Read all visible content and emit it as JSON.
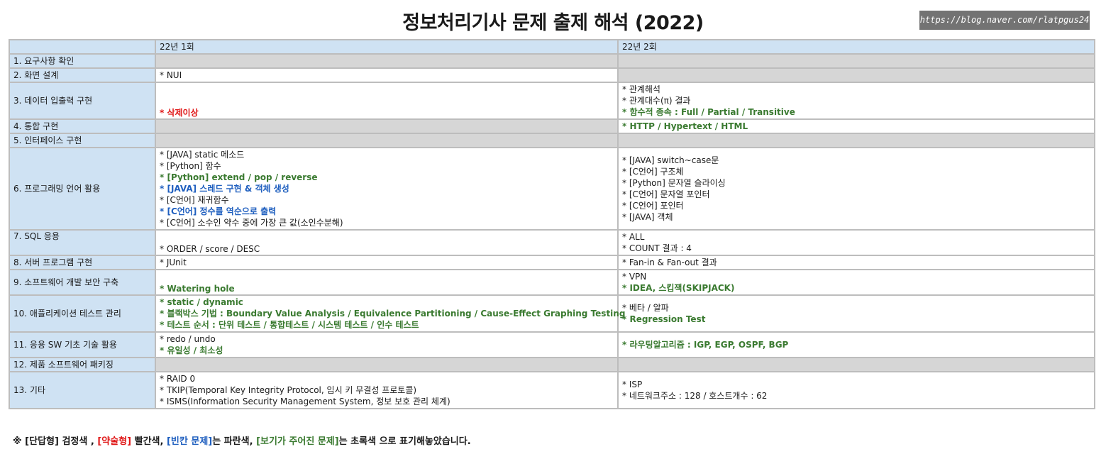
{
  "title": "정보처리기사 문제 출제 해석 (2022)",
  "watermark": "https://blog.naver.com/rlatpgus24",
  "table": {
    "headers": [
      "",
      "22년 1회",
      "22년 2회"
    ],
    "rows": [
      {
        "category": "1. 요구사항 확인",
        "c1": [],
        "c2": [],
        "h": 20
      },
      {
        "category": "2. 화면 설계",
        "c1": [
          {
            "t": "* NUI",
            "s": "plain"
          }
        ],
        "c2": [],
        "h": 20
      },
      {
        "category": "3. 데이터 입출력 구현",
        "c1": [
          {
            "t": "* 삭제이상",
            "s": "red"
          }
        ],
        "c2": [
          {
            "t": "* 관계해석",
            "s": "plain"
          },
          {
            "t": "* 관계대수(π) 결과",
            "s": "plain"
          },
          {
            "t": "* 함수적 종속 : Full / Partial / Transitive",
            "s": "green"
          }
        ],
        "c1_align": "bottom",
        "h": 52
      },
      {
        "category": "4. 통합 구현",
        "c1": [],
        "c2": [
          {
            "t": "* HTTP / Hypertext / HTML",
            "s": "green"
          }
        ],
        "h": 20
      },
      {
        "category": "5. 인터페이스 구현",
        "c1": [],
        "c2": [],
        "h": 20
      },
      {
        "category": "6. 프로그래밍 언어 활용",
        "c1": [
          {
            "t": "* [JAVA] static 메소드",
            "s": "plain"
          },
          {
            "t": "* [Python] 함수",
            "s": "plain"
          },
          {
            "t": "* [Python] extend / pop / reverse",
            "s": "green"
          },
          {
            "t": "* [JAVA] 스레드 구현 & 객체 생성",
            "s": "blue"
          },
          {
            "t": "* [C언어] 재귀함수",
            "s": "plain"
          },
          {
            "t": "* [C언어] 정수를 역순으로 출력",
            "s": "blue"
          },
          {
            "t": "* [C언어] 소수인 약수 중에 가장 큰 값(소인수분해)",
            "s": "plain"
          }
        ],
        "c2": [
          {
            "t": "* [JAVA] switch~case문",
            "s": "plain"
          },
          {
            "t": "* [C언어] 구조체",
            "s": "plain"
          },
          {
            "t": "* [Python] 문자열 슬라이싱",
            "s": "plain"
          },
          {
            "t": "* [C언어] 문자열 포인터",
            "s": "plain"
          },
          {
            "t": "* [C언어] 포인터",
            "s": "plain"
          },
          {
            "t": "* [JAVA] 객체",
            "s": "plain"
          }
        ],
        "h": 116
      },
      {
        "category": "7. SQL 응용",
        "c1": [
          {
            "t": "* ORDER / score / DESC",
            "s": "plain"
          }
        ],
        "c2": [
          {
            "t": "* ALL",
            "s": "plain"
          },
          {
            "t": "* COUNT 결과 : 4",
            "s": "plain"
          }
        ],
        "c1_align": "bottom",
        "cat_align": "top",
        "h": 36
      },
      {
        "category": "8. 서버 프로그램 구현",
        "c1": [
          {
            "t": "* JUnit",
            "s": "plain"
          }
        ],
        "c2": [
          {
            "t": "* Fan-in & Fan-out 결과",
            "s": "plain"
          }
        ],
        "h": 20
      },
      {
        "category": "9. 소프트웨어 개발 보안 구축",
        "c1": [
          {
            "t": "* Watering hole",
            "s": "green"
          }
        ],
        "c2": [
          {
            "t": "* VPN",
            "s": "plain"
          },
          {
            "t": "* IDEA, 스킵잭(SKIPJACK)",
            "s": "green"
          }
        ],
        "c1_align": "bottom",
        "h": 36
      },
      {
        "category": "10. 애플리케이션 테스트 관리",
        "c1": [
          {
            "t": "* static / dynamic",
            "s": "green"
          },
          {
            "t": "* 블랙박스 기법 : Boundary Value Analysis / Equivalence Partitioning / Cause-Effect Graphing Testing",
            "s": "green"
          },
          {
            "t": "* 테스트 순서 : 단위 테스트 / 통합테스트 / 시스템 테스트 / 인수 테스트",
            "s": "green"
          }
        ],
        "c2": [
          {
            "t": "* 베타 / 알파",
            "s": "plain"
          },
          {
            "t": "* Regression Test",
            "s": "green"
          }
        ],
        "h": 52
      },
      {
        "category": "11. 응용 SW 기초 기술 활용",
        "c1": [
          {
            "t": "* redo / undo",
            "s": "plain"
          },
          {
            "t": "* 유일성 / 최소성",
            "s": "green"
          }
        ],
        "c2": [
          {
            "t": "* 라우팅알고리즘 : IGP, EGP, OSPF, BGP",
            "s": "green"
          }
        ],
        "h": 36
      },
      {
        "category": "12. 제품 소프트웨어 패키징",
        "c1": [],
        "c2": [],
        "h": 20
      },
      {
        "category": "13. 기타",
        "c1": [
          {
            "t": "* RAID 0",
            "s": "plain"
          },
          {
            "t": "* TKIP(Temporal Key Integrity Protocol, 임시 키 무결성 프로토콜)",
            "s": "plain"
          },
          {
            "t": "* ISMS(Information Security Management System, 정보 보호 관리 체계)",
            "s": "plain"
          }
        ],
        "c2": [
          {
            "t": "* ISP",
            "s": "plain"
          },
          {
            "t": "* 네트워크주소 : 128 / 호스트개수 : 62",
            "s": "plain"
          }
        ],
        "h": 52
      }
    ]
  },
  "footer": [
    {
      "t": "※  [단답형] 검정색 ,  ",
      "s": "plain"
    },
    {
      "t": "[약술형]",
      "s": "red"
    },
    {
      "t": " 빨간색,  ",
      "s": "plain"
    },
    {
      "t": "[빈칸 문제]",
      "s": "blue"
    },
    {
      "t": "는 파란색, ",
      "s": "plain"
    },
    {
      "t": "[보기가 주어진 문제]",
      "s": "green"
    },
    {
      "t": "는 초록색 으로 표기해놓았습니다.",
      "s": "plain"
    }
  ]
}
